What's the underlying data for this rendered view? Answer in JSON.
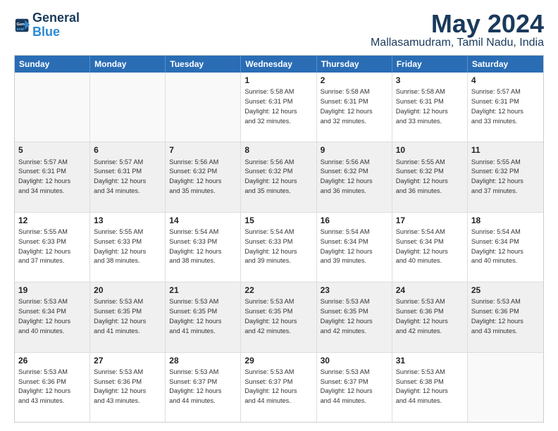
{
  "logo": {
    "line1": "General",
    "line2": "Blue"
  },
  "header": {
    "month": "May 2024",
    "location": "Mallasamudram, Tamil Nadu, India"
  },
  "weekdays": [
    "Sunday",
    "Monday",
    "Tuesday",
    "Wednesday",
    "Thursday",
    "Friday",
    "Saturday"
  ],
  "rows": [
    [
      {
        "day": "",
        "empty": true
      },
      {
        "day": "",
        "empty": true
      },
      {
        "day": "",
        "empty": true
      },
      {
        "day": "1",
        "line1": "Sunrise: 5:58 AM",
        "line2": "Sunset: 6:31 PM",
        "line3": "Daylight: 12 hours",
        "line4": "and 32 minutes."
      },
      {
        "day": "2",
        "line1": "Sunrise: 5:58 AM",
        "line2": "Sunset: 6:31 PM",
        "line3": "Daylight: 12 hours",
        "line4": "and 32 minutes."
      },
      {
        "day": "3",
        "line1": "Sunrise: 5:58 AM",
        "line2": "Sunset: 6:31 PM",
        "line3": "Daylight: 12 hours",
        "line4": "and 33 minutes."
      },
      {
        "day": "4",
        "line1": "Sunrise: 5:57 AM",
        "line2": "Sunset: 6:31 PM",
        "line3": "Daylight: 12 hours",
        "line4": "and 33 minutes."
      }
    ],
    [
      {
        "day": "5",
        "line1": "Sunrise: 5:57 AM",
        "line2": "Sunset: 6:31 PM",
        "line3": "Daylight: 12 hours",
        "line4": "and 34 minutes."
      },
      {
        "day": "6",
        "line1": "Sunrise: 5:57 AM",
        "line2": "Sunset: 6:31 PM",
        "line3": "Daylight: 12 hours",
        "line4": "and 34 minutes."
      },
      {
        "day": "7",
        "line1": "Sunrise: 5:56 AM",
        "line2": "Sunset: 6:32 PM",
        "line3": "Daylight: 12 hours",
        "line4": "and 35 minutes."
      },
      {
        "day": "8",
        "line1": "Sunrise: 5:56 AM",
        "line2": "Sunset: 6:32 PM",
        "line3": "Daylight: 12 hours",
        "line4": "and 35 minutes."
      },
      {
        "day": "9",
        "line1": "Sunrise: 5:56 AM",
        "line2": "Sunset: 6:32 PM",
        "line3": "Daylight: 12 hours",
        "line4": "and 36 minutes."
      },
      {
        "day": "10",
        "line1": "Sunrise: 5:55 AM",
        "line2": "Sunset: 6:32 PM",
        "line3": "Daylight: 12 hours",
        "line4": "and 36 minutes."
      },
      {
        "day": "11",
        "line1": "Sunrise: 5:55 AM",
        "line2": "Sunset: 6:32 PM",
        "line3": "Daylight: 12 hours",
        "line4": "and 37 minutes."
      }
    ],
    [
      {
        "day": "12",
        "line1": "Sunrise: 5:55 AM",
        "line2": "Sunset: 6:33 PM",
        "line3": "Daylight: 12 hours",
        "line4": "and 37 minutes."
      },
      {
        "day": "13",
        "line1": "Sunrise: 5:55 AM",
        "line2": "Sunset: 6:33 PM",
        "line3": "Daylight: 12 hours",
        "line4": "and 38 minutes."
      },
      {
        "day": "14",
        "line1": "Sunrise: 5:54 AM",
        "line2": "Sunset: 6:33 PM",
        "line3": "Daylight: 12 hours",
        "line4": "and 38 minutes."
      },
      {
        "day": "15",
        "line1": "Sunrise: 5:54 AM",
        "line2": "Sunset: 6:33 PM",
        "line3": "Daylight: 12 hours",
        "line4": "and 39 minutes."
      },
      {
        "day": "16",
        "line1": "Sunrise: 5:54 AM",
        "line2": "Sunset: 6:34 PM",
        "line3": "Daylight: 12 hours",
        "line4": "and 39 minutes."
      },
      {
        "day": "17",
        "line1": "Sunrise: 5:54 AM",
        "line2": "Sunset: 6:34 PM",
        "line3": "Daylight: 12 hours",
        "line4": "and 40 minutes."
      },
      {
        "day": "18",
        "line1": "Sunrise: 5:54 AM",
        "line2": "Sunset: 6:34 PM",
        "line3": "Daylight: 12 hours",
        "line4": "and 40 minutes."
      }
    ],
    [
      {
        "day": "19",
        "line1": "Sunrise: 5:53 AM",
        "line2": "Sunset: 6:34 PM",
        "line3": "Daylight: 12 hours",
        "line4": "and 40 minutes."
      },
      {
        "day": "20",
        "line1": "Sunrise: 5:53 AM",
        "line2": "Sunset: 6:35 PM",
        "line3": "Daylight: 12 hours",
        "line4": "and 41 minutes."
      },
      {
        "day": "21",
        "line1": "Sunrise: 5:53 AM",
        "line2": "Sunset: 6:35 PM",
        "line3": "Daylight: 12 hours",
        "line4": "and 41 minutes."
      },
      {
        "day": "22",
        "line1": "Sunrise: 5:53 AM",
        "line2": "Sunset: 6:35 PM",
        "line3": "Daylight: 12 hours",
        "line4": "and 42 minutes."
      },
      {
        "day": "23",
        "line1": "Sunrise: 5:53 AM",
        "line2": "Sunset: 6:35 PM",
        "line3": "Daylight: 12 hours",
        "line4": "and 42 minutes."
      },
      {
        "day": "24",
        "line1": "Sunrise: 5:53 AM",
        "line2": "Sunset: 6:36 PM",
        "line3": "Daylight: 12 hours",
        "line4": "and 42 minutes."
      },
      {
        "day": "25",
        "line1": "Sunrise: 5:53 AM",
        "line2": "Sunset: 6:36 PM",
        "line3": "Daylight: 12 hours",
        "line4": "and 43 minutes."
      }
    ],
    [
      {
        "day": "26",
        "line1": "Sunrise: 5:53 AM",
        "line2": "Sunset: 6:36 PM",
        "line3": "Daylight: 12 hours",
        "line4": "and 43 minutes."
      },
      {
        "day": "27",
        "line1": "Sunrise: 5:53 AM",
        "line2": "Sunset: 6:36 PM",
        "line3": "Daylight: 12 hours",
        "line4": "and 43 minutes."
      },
      {
        "day": "28",
        "line1": "Sunrise: 5:53 AM",
        "line2": "Sunset: 6:37 PM",
        "line3": "Daylight: 12 hours",
        "line4": "and 44 minutes."
      },
      {
        "day": "29",
        "line1": "Sunrise: 5:53 AM",
        "line2": "Sunset: 6:37 PM",
        "line3": "Daylight: 12 hours",
        "line4": "and 44 minutes."
      },
      {
        "day": "30",
        "line1": "Sunrise: 5:53 AM",
        "line2": "Sunset: 6:37 PM",
        "line3": "Daylight: 12 hours",
        "line4": "and 44 minutes."
      },
      {
        "day": "31",
        "line1": "Sunrise: 5:53 AM",
        "line2": "Sunset: 6:38 PM",
        "line3": "Daylight: 12 hours",
        "line4": "and 44 minutes."
      },
      {
        "day": "",
        "empty": true
      }
    ]
  ]
}
